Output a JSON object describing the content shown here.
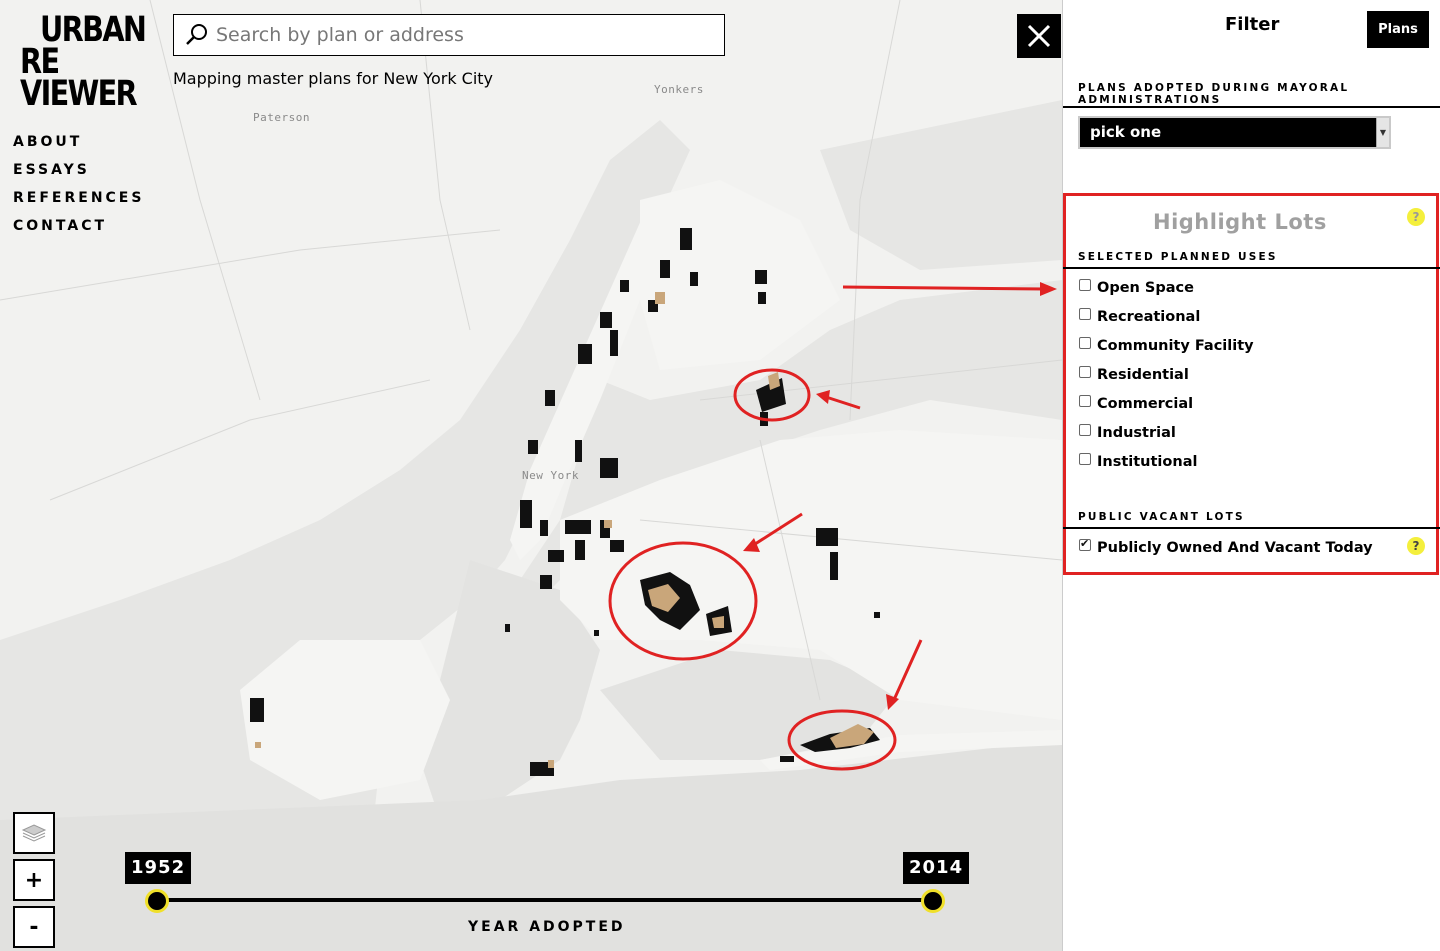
{
  "logo": {
    "line1": "URBAN",
    "line2": "RE",
    "line3": "VIEWER"
  },
  "nav": [
    "ABOUT",
    "ESSAYS",
    "REFERENCES",
    "CONTACT"
  ],
  "search": {
    "placeholder": "Search by plan or address",
    "value": ""
  },
  "tagline": "Mapping master plans for New York City",
  "map": {
    "place_labels": {
      "paterson": "Paterson",
      "yonkers": "Yonkers",
      "new_york": "New York"
    },
    "controls": {
      "zoom_in": "+",
      "zoom_out": "-"
    }
  },
  "timeline": {
    "start_year": "1952",
    "end_year": "2014",
    "label": "YEAR ADOPTED"
  },
  "sidebar": {
    "title": "Filter",
    "plans_button": "Plans",
    "mayoral_heading": "PLANS ADOPTED DURING MAYORAL ADMINISTRATIONS",
    "mayoral_select": "pick one",
    "highlight_title": "Highlight Lots",
    "help": "?",
    "uses_heading": "SELECTED PLANNED USES",
    "uses": [
      {
        "label": "Open Space",
        "checked": false
      },
      {
        "label": "Recreational",
        "checked": false
      },
      {
        "label": "Community Facility",
        "checked": false
      },
      {
        "label": "Residential",
        "checked": false
      },
      {
        "label": "Commercial",
        "checked": false
      },
      {
        "label": "Industrial",
        "checked": false
      },
      {
        "label": "Institutional",
        "checked": false
      }
    ],
    "vacant_heading": "PUBLIC VACANT LOTS",
    "vacant_option": {
      "label": "Publicly Owned And Vacant Today",
      "checked": true
    }
  },
  "colors": {
    "annotation": "#e02222",
    "slider_ring": "#f0e02a",
    "lot_dark": "#111111",
    "lot_tan": "#c9a67a",
    "help_icon": "#f4ef3c"
  }
}
